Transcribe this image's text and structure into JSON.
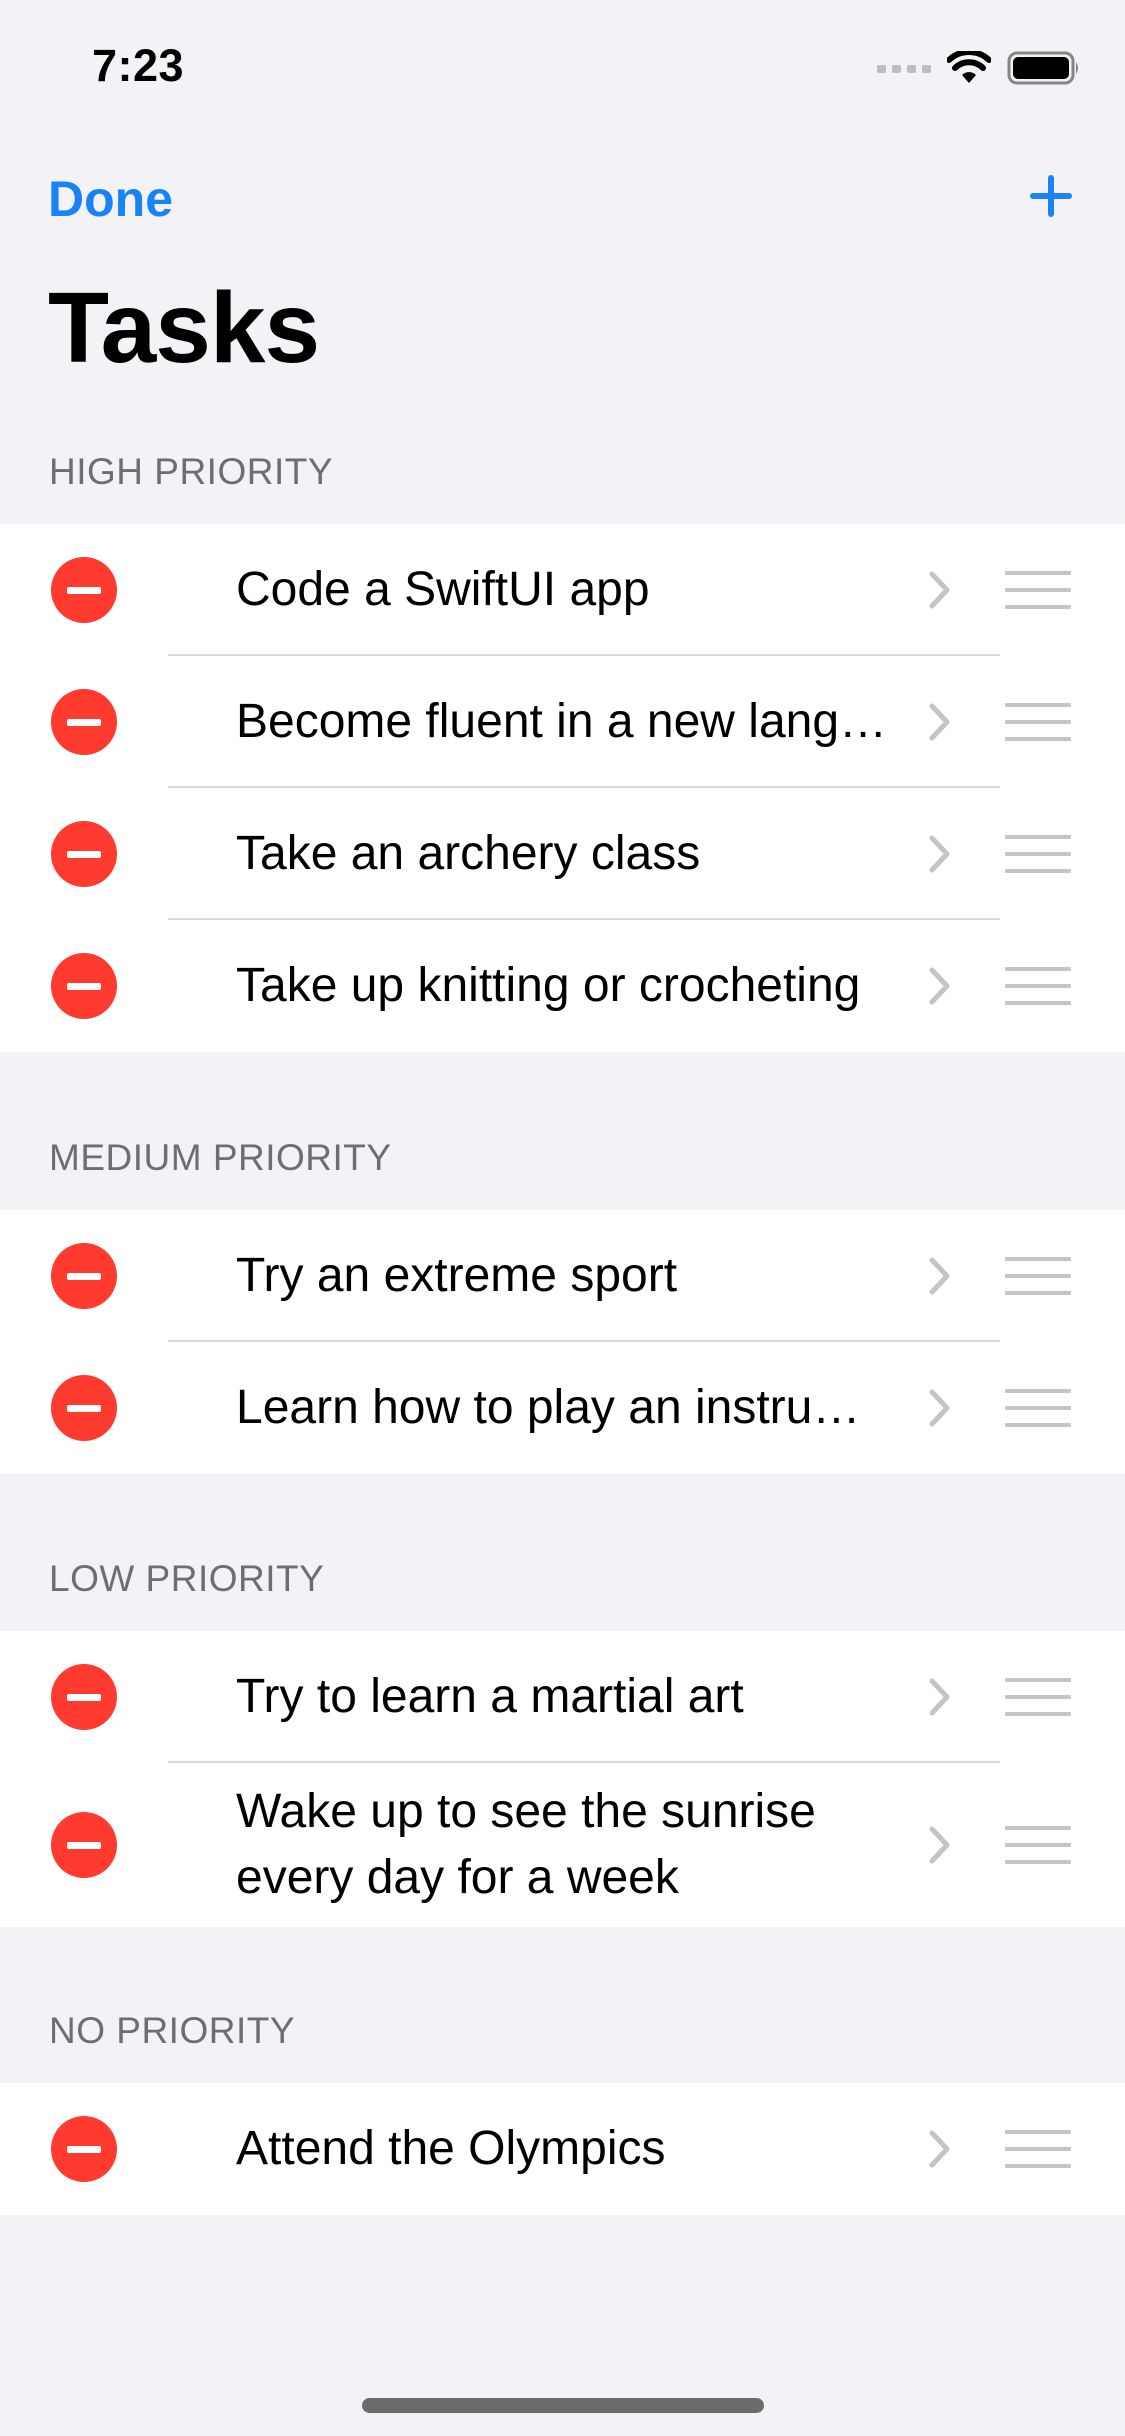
{
  "status_bar": {
    "time": "7:23",
    "icons": [
      "cellular-signal-icon",
      "wifi-icon",
      "battery-icon"
    ]
  },
  "nav": {
    "done_label": "Done",
    "add_icon": "plus-icon",
    "title": "Tasks"
  },
  "colors": {
    "accent": "#1A82F7",
    "delete": "#FF3B30",
    "background": "#F2F2F7",
    "section_header": "#6D6D72"
  },
  "sections": [
    {
      "header": "HIGH PRIORITY",
      "items": [
        {
          "label": "Code a SwiftUI app"
        },
        {
          "label": "Become fluent in a new language"
        },
        {
          "label": "Take an archery class"
        },
        {
          "label": "Take up knitting or crocheting"
        }
      ]
    },
    {
      "header": "MEDIUM PRIORITY",
      "items": [
        {
          "label": "Try an extreme sport"
        },
        {
          "label": "Learn how to play an instrument"
        }
      ]
    },
    {
      "header": "LOW PRIORITY",
      "items": [
        {
          "label": "Try to learn a martial art"
        },
        {
          "label": "Wake up to see the sunrise every day for a week"
        }
      ]
    },
    {
      "header": "NO PRIORITY",
      "items": [
        {
          "label": "Attend the Olympics"
        }
      ]
    }
  ]
}
